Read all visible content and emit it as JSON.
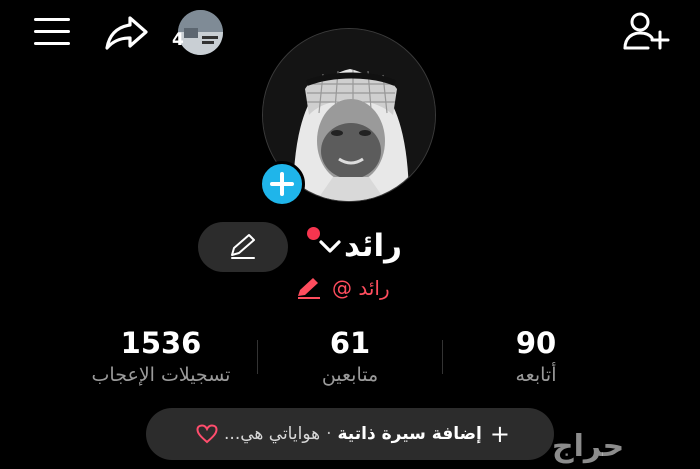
{
  "top_bar": {
    "story_count": "4",
    "icons": {
      "menu": "hamburger-menu-icon",
      "share": "share-arrow-icon",
      "add_user": "add-user-icon"
    }
  },
  "profile": {
    "display_name": "رائد",
    "handle": "رائد @",
    "online_dot_color": "#f6354f",
    "add_button_color": "#1fb5ea",
    "handle_color": "#ff4d5e"
  },
  "stats": [
    {
      "value": "1536",
      "label": "تسجيلات الإعجاب"
    },
    {
      "value": "61",
      "label": "متابعين"
    },
    {
      "value": "90",
      "label": "أتابعه"
    }
  ],
  "bio": {
    "add_label": "إضافة سيرة ذاتية",
    "separator": "·",
    "hobbies_text": "هواياتي هي..."
  },
  "watermark": "حراج"
}
